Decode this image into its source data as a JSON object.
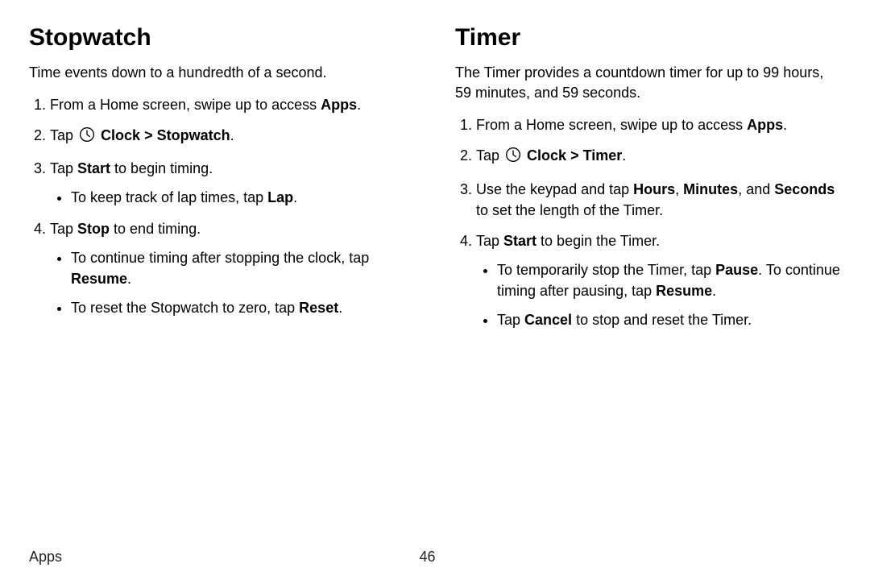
{
  "left": {
    "heading": "Stopwatch",
    "intro": "Time events down to a hundredth of a second.",
    "s1_pre": "From a Home screen, swipe up to access ",
    "s1_b1": "Apps",
    "s1_post": ".",
    "s2_pre": "Tap ",
    "s2_b1": "Clock",
    "s2_chev": " > ",
    "s2_b2": "Stopwatch",
    "s2_post": ".",
    "s3_pre": "Tap ",
    "s3_b1": "Start",
    "s3_post": " to begin timing.",
    "s3_sub1_pre": "To keep track of lap times, tap ",
    "s3_sub1_b1": "Lap",
    "s3_sub1_post": ".",
    "s4_pre": "Tap ",
    "s4_b1": "Stop",
    "s4_post": " to end timing.",
    "s4_sub1_pre": "To continue timing after stopping the clock, tap ",
    "s4_sub1_b1": "Resume",
    "s4_sub1_post": ".",
    "s4_sub2_pre": "To reset the Stopwatch to zero, tap ",
    "s4_sub2_b1": "Reset",
    "s4_sub2_post": "."
  },
  "right": {
    "heading": "Timer",
    "intro": "The Timer provides a countdown timer for up to 99 hours, 59 minutes, and 59 seconds.",
    "s1_pre": "From a Home screen, swipe up to access ",
    "s1_b1": "Apps",
    "s1_post": ".",
    "s2_pre": "Tap ",
    "s2_b1": "Clock",
    "s2_chev": " > ",
    "s2_b2": "Timer",
    "s2_post": ".",
    "s3_pre": "Use the keypad and tap ",
    "s3_b1": "Hours",
    "s3_mid1": ", ",
    "s3_b2": "Minutes",
    "s3_mid2": ", and ",
    "s3_b3": "Seconds",
    "s3_post": " to set the length of the Timer.",
    "s4_pre": "Tap ",
    "s4_b1": "Start",
    "s4_post": " to begin the Timer.",
    "s4_sub1_pre": "To temporarily stop the Timer, tap ",
    "s4_sub1_b1": "Pause",
    "s4_sub1_mid": ". To continue timing after pausing, tap ",
    "s4_sub1_b2": "Resume",
    "s4_sub1_post": ".",
    "s4_sub2_pre": "Tap ",
    "s4_sub2_b1": "Cancel",
    "s4_sub2_post": " to stop and reset the Timer."
  },
  "footer": {
    "section": "Apps",
    "page": "46"
  }
}
